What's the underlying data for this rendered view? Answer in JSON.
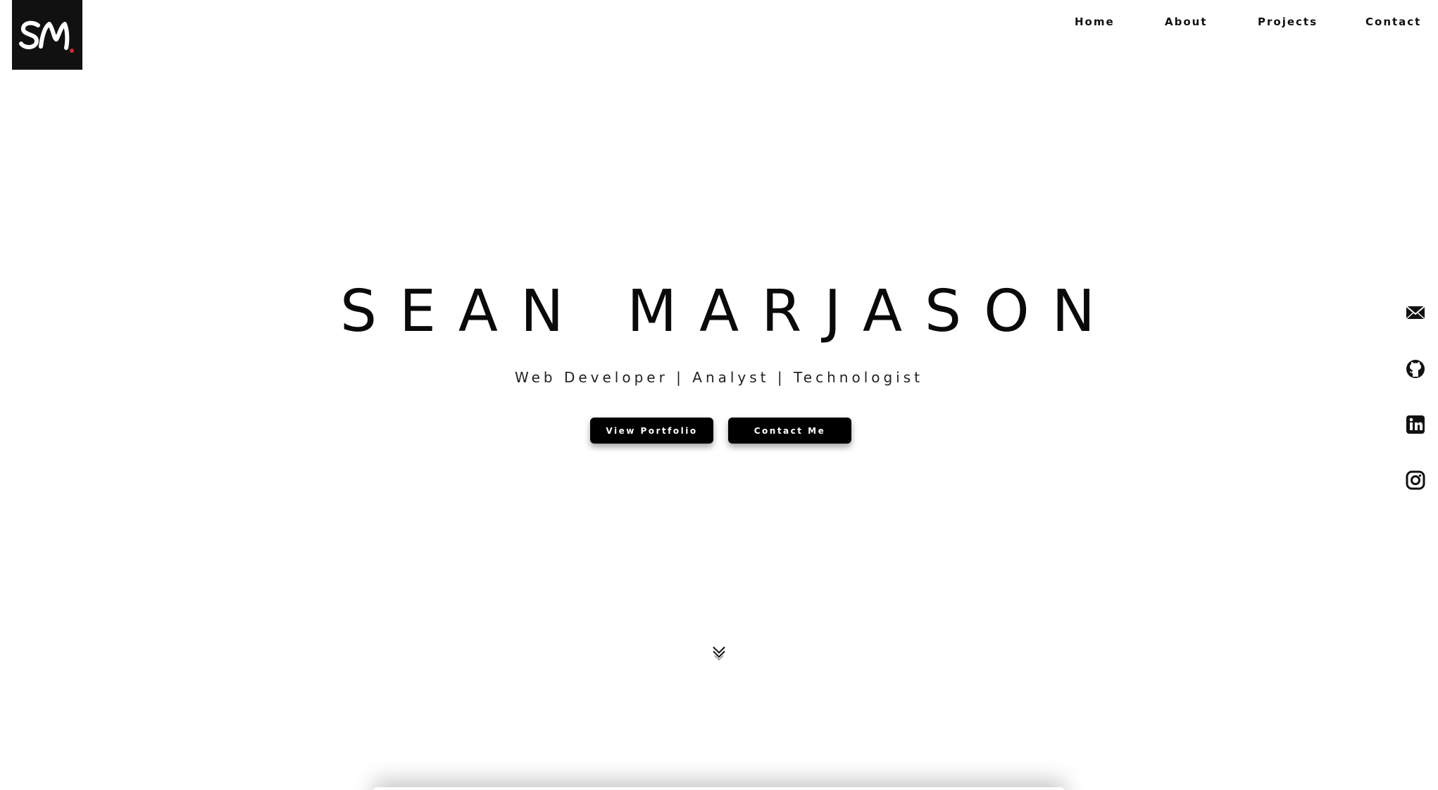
{
  "logo": {
    "text": "SM",
    "accent_color": "#d62828",
    "background": "#111111"
  },
  "nav": {
    "items": [
      {
        "label": "Home"
      },
      {
        "label": "About"
      },
      {
        "label": "Projects"
      },
      {
        "label": "Contact"
      }
    ]
  },
  "hero": {
    "title": "SEAN MARJASON",
    "subtitle": "Web Developer | Analyst | Technologist",
    "buttons": {
      "portfolio_label": "View Portfolio",
      "contact_label": "Contact Me"
    }
  },
  "social": {
    "icons": [
      "email-icon",
      "github-icon",
      "linkedin-icon",
      "instagram-icon"
    ]
  },
  "scroll": {
    "icon": "double-chevron-down-icon"
  }
}
